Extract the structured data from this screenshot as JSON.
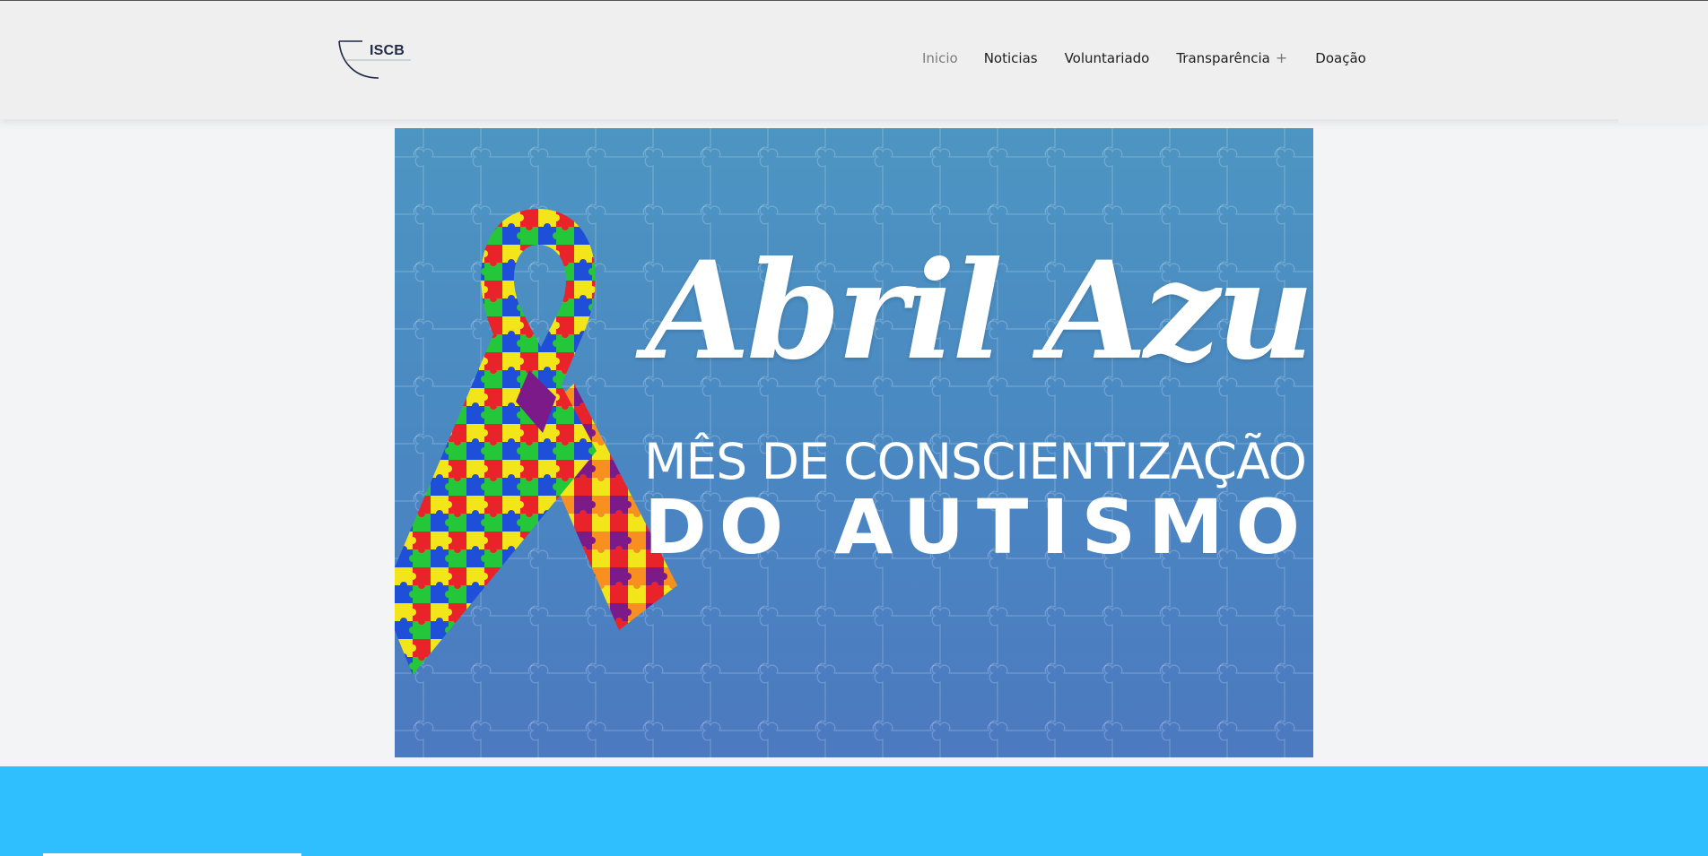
{
  "brand": {
    "logo_text": "ISCB"
  },
  "nav": {
    "items": [
      {
        "label": "Inicio",
        "active": true
      },
      {
        "label": "Noticias"
      },
      {
        "label": "Voluntariado"
      },
      {
        "label": "Transparência",
        "has_submenu": true
      },
      {
        "label": "Doação"
      }
    ],
    "submenu_icon": "plus-icon"
  },
  "banner": {
    "title": "Abril Azul",
    "line1": "MÊS DE CONSCIENTIZAÇÃO",
    "line2": "DO AUTISMO",
    "ribbon": "puzzle-ribbon-icon"
  },
  "colors": {
    "header_bg": "#efefef",
    "banner_top": "#4d95c2",
    "banner_bottom": "#4c79c0",
    "footer_bg": "#2fbfff"
  }
}
